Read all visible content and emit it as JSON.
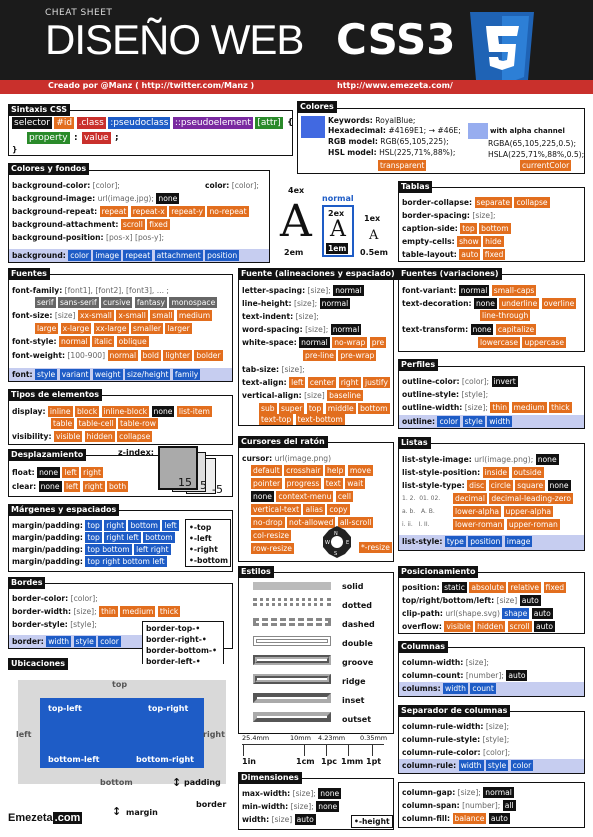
{
  "header": {
    "cheat": "CHEAT SHEET",
    "title_a": "DISEÑO WEB ",
    "title_b": "CSS3",
    "credit_by": "Creado por @Manz ( http://twitter.com/Manz )",
    "credit_url": "http://www.emezeta.com/",
    "shield_num": "3"
  },
  "sintaxis": {
    "title": "Sintaxis CSS",
    "sel": "selector",
    "id": "#id",
    "cls": ".class",
    "pc": ":pseudoclass",
    "pe": "::pseudoelement",
    "attr": "[attr]",
    "brace": "{",
    "prop": "property",
    "colon": ":",
    "val": "value",
    "semi": ";",
    "close": "}"
  },
  "colores": {
    "title": "Colores",
    "kw_l": "Keywords:",
    "kw_v": "RoyalBlue;",
    "hex_l": "Hexadecimal:",
    "hex_v": "#4169E1; → #46E;",
    "rgb_l": "RGB model:",
    "rgb_v": "RGB(65,105,225);",
    "hsl_l": "HSL model:",
    "hsl_v": "HSL(225,71%,88%);",
    "transparent": "transparent",
    "alpha": "with alpha channel",
    "rgba": "RGBA(65,105,225,0.5);",
    "hsla": "HSLA(225,71%,88%,0.5);",
    "current": "currentColor"
  },
  "fondos": {
    "title": "Colores y fondos",
    "r1l": "background-color:",
    "r1v": "[color];",
    "r1r": "color:",
    "r1rv": "[color];",
    "r2l": "background-image:",
    "r2v": "url(image.jpg);",
    "r2b": "none",
    "r3l": "background-repeat:",
    "r3a": "repeat",
    "r3b": "repeat-x",
    "r3c": "repeat-y",
    "r3d": "no-repeat",
    "r4l": "background-attachment:",
    "r4a": "scroll",
    "r4b": "fixed",
    "r5l": "background-position:",
    "r5v": "[pos-x] [pos-y];",
    "sh": "background:",
    "s1": "color",
    "s2": "image",
    "s3": "repeat",
    "s4": "attachment",
    "s5": "position"
  },
  "ems": {
    "a4": "4ex",
    "norm": "normal",
    "a2ex": "2ex",
    "a1ex": "1ex",
    "a2em": "2em",
    "a1em": "1em",
    "a05": "0.5em",
    "glyph": "A"
  },
  "tablas": {
    "title": "Tablas",
    "r1l": "border-collapse:",
    "r1a": "separate",
    "r1b": "collapse",
    "r2l": "border-spacing:",
    "r2v": "[size];",
    "r3l": "caption-side:",
    "r3a": "top",
    "r3b": "bottom",
    "r4l": "empty-cells:",
    "r4a": "show",
    "r4b": "hide",
    "r5l": "table-layout:",
    "r5a": "auto",
    "r5b": "fixed"
  },
  "fuentes": {
    "title": "Fuentes",
    "r1l": "font-family:",
    "r1v": "[font1], [font2], [font3], ... ;",
    "f1": "serif",
    "f2": "sans-serif",
    "f3": "cursive",
    "f4": "fantasy",
    "f5": "monospace",
    "r2l": "font-size:",
    "r2v": "[size]",
    "s1": "xx-small",
    "s2": "x-small",
    "s3": "small",
    "s4": "medium",
    "s5": "large",
    "s6": "x-large",
    "s7": "xx-large",
    "s8": "smaller",
    "s9": "larger",
    "r3l": "font-style:",
    "r3a": "normal",
    "r3b": "italic",
    "r3c": "oblique",
    "r4l": "font-weight:",
    "r4v": "[100-900]",
    "r4a": "normal",
    "r4b": "bold",
    "r4c": "lighter",
    "r4d": "bolder",
    "sh": "font:",
    "h1": "style",
    "h2": "variant",
    "h3": "weight",
    "h4": "size/height",
    "h5": "family"
  },
  "alin": {
    "title": "Fuente (alineaciones y espaciado)",
    "r1l": "letter-spacing:",
    "r1v": "[size];",
    "r1a": "normal",
    "r2l": "line-height:",
    "r2v": "[size];",
    "r2a": "normal",
    "r3l": "text-indent:",
    "r3v": "[size];",
    "r4l": "word-spacing:",
    "r4v": "[size];",
    "r4a": "normal",
    "r5l": "white-space:",
    "r5a": "normal",
    "r5b": "no-wrap",
    "r5c": "pre",
    "r5d": "pre-line",
    "r5e": "pre-wrap",
    "r6l": "tab-size:",
    "r6v": "[size];",
    "r7l": "text-align:",
    "r7a": "left",
    "r7b": "center",
    "r7c": "right",
    "r7d": "justify",
    "r8l": "vertical-align:",
    "r8v": "[size]",
    "r8a": "baseline",
    "r8b": "sub",
    "r8c": "super",
    "r8d": "top",
    "r8e": "middle",
    "r8f": "bottom",
    "r8g": "text-top",
    "r8h": "text-bottom"
  },
  "variac": {
    "title": "Fuentes (variaciones)",
    "r1l": "font-variant:",
    "r1a": "normal",
    "r1b": "small-caps",
    "r2l": "text-decoration:",
    "r2a": "none",
    "r2b": "underline",
    "r2c": "overline",
    "r2d": "line-through",
    "r3l": "text-transform:",
    "r3a": "none",
    "r3b": "capitalize",
    "r3c": "lowercase",
    "r3d": "uppercase"
  },
  "elementos": {
    "title": "Tipos de elementos",
    "r1l": "display:",
    "r1a": "inline",
    "r1b": "block",
    "r1c": "inline-block",
    "r1d": "none",
    "r1e": "list-item",
    "r1f": "table",
    "r1g": "table-cell",
    "r1h": "table-row",
    "r2l": "visibility:",
    "r2a": "visible",
    "r2b": "hidden",
    "r2c": "collapse"
  },
  "perfiles": {
    "title": "Perfiles",
    "r1l": "outline-color:",
    "r1v": "[color];",
    "r1a": "invert",
    "r2l": "outline-style:",
    "r2v": "[style];",
    "r3l": "outline-width:",
    "r3v": "[size];",
    "r3a": "thin",
    "r3b": "medium",
    "r3c": "thick",
    "sh": "outline:",
    "h1": "color",
    "h2": "style",
    "h3": "width"
  },
  "despl": {
    "title": "Desplazamiento",
    "z": "z-index:",
    "r1l": "float:",
    "r1a": "none",
    "r1b": "left",
    "r1c": "right",
    "r2l": "clear:",
    "r2a": "none",
    "r2b": "left",
    "r2c": "right",
    "r2d": "both",
    "n15": "15",
    "n5": "5",
    "n_5": "-5"
  },
  "cursores": {
    "title": "Cursores del ratón",
    "r1l": "cursor:",
    "r1v": "url(image.png)",
    "c1": "default",
    "c2": "crosshair",
    "c3": "help",
    "c4": "move",
    "c5": "pointer",
    "c6": "progress",
    "c7": "text",
    "c8": "wait",
    "c9": "none",
    "c10": "context-menu",
    "c11": "cell",
    "c12": "vertical-text",
    "c13": "alias",
    "c14": "copy",
    "c15": "no-drop",
    "c16": "not-allowed",
    "c17": "all-scroll",
    "c18": "col-resize",
    "c19": "row-resize",
    "c20": "*-resize"
  },
  "listas": {
    "title": "Listas",
    "r1l": "list-style-image:",
    "r1v": "url(image.png);",
    "r1a": "none",
    "r2l": "list-style-position:",
    "r2a": "inside",
    "r2b": "outside",
    "r3l": "list-style-type:",
    "r3a": "disc",
    "r3b": "circle",
    "r3c": "square",
    "r3d": "none",
    "n1": "1.  2.",
    "n2": "01. 02.",
    "n3": "a.   b.",
    "n4": "A.   B.",
    "n5": "i.  ii.",
    "n6": "I.   II.",
    "l1": "decimal",
    "l2": "decimal-leading-zero",
    "l3": "lower-alpha",
    "l4": "upper-alpha",
    "l5": "lower-roman",
    "l6": "upper-roman",
    "sh": "list-style:",
    "h1": "type",
    "h2": "position",
    "h3": "image"
  },
  "margenes": {
    "title": "Márgenes y espaciados",
    "lab": "margin/padding:",
    "a1": "top",
    "a2": "right",
    "a3": "bottom",
    "a4": "left",
    "b1": "top",
    "b2": "right left",
    "b3": "bottom",
    "c1": "top bottom",
    "c2": "left right",
    "d1": "top right bottom left",
    "k1": "•-top",
    "k2": "•-left",
    "k3": "•-right",
    "k4": "•-bottom"
  },
  "estilos": {
    "title": "Estilos",
    "e1": "solid",
    "e2": "dotted",
    "e3": "dashed",
    "e4": "double",
    "e5": "groove",
    "e6": "ridge",
    "e7": "inset",
    "e8": "outset"
  },
  "posic": {
    "title": "Posicionamiento",
    "r1l": "position:",
    "r1a": "static",
    "r1b": "absolute",
    "r1c": "relative",
    "r1d": "fixed",
    "r2l": "top/right/bottom/left:",
    "r2v": "[size]",
    "r2a": "auto",
    "r3l": "clip-path:",
    "r3v": "url(shape.svg)",
    "r3a": "shape",
    "r3b": "auto",
    "r4l": "overflow:",
    "r4a": "visible",
    "r4b": "hidden",
    "r4c": "scroll",
    "r4d": "auto"
  },
  "bordes": {
    "title": "Bordes",
    "r1l": "border-color:",
    "r1v": "[color];",
    "r2l": "border-width:",
    "r2v": "[size];",
    "r2a": "thin",
    "r2b": "medium",
    "r2c": "thick",
    "r3l": "border-style:",
    "r3v": "[style];",
    "sh": "border:",
    "h1": "width",
    "h2": "style",
    "h3": "color",
    "k1": "border-top-•",
    "k2": "border-right-•",
    "k3": "border-bottom-•",
    "k4": "border-left-•"
  },
  "columnas": {
    "title": "Columnas",
    "r1l": "column-width:",
    "r1v": "[size];",
    "r2l": "column-count:",
    "r2v": "[number];",
    "r2a": "auto",
    "sh": "columns:",
    "h1": "width",
    "h2": "count"
  },
  "ubic": {
    "title": "Ubicaciones",
    "top": "top",
    "left": "left",
    "right": "right",
    "bottom": "bottom",
    "tl": "top-left",
    "tr": "top-right",
    "bl": "bottom-left",
    "br": "bottom-right",
    "pad": "padding",
    "mar": "margin",
    "bor": "border"
  },
  "medidas": {
    "m1": "25.4mm",
    "m2": "10mm",
    "m3": "4.23mm",
    "m4": "0.35mm",
    "u1": "1in",
    "u2": "1cm",
    "u3": "1pc",
    "u4": "1mm",
    "u5": "1pt"
  },
  "separador": {
    "title": "Separador de columnas",
    "r1l": "column-rule-width:",
    "r1v": "[size];",
    "r2l": "column-rule-style:",
    "r2v": "[style];",
    "r3l": "column-rule-color:",
    "r3v": "[color];",
    "sh": "column-rule:",
    "h1": "width",
    "h2": "style",
    "h3": "color"
  },
  "dimens": {
    "title": "Dimensiones",
    "r1l": "max-width:",
    "r1v": "[size];",
    "r1a": "none",
    "r2l": "min-width:",
    "r2v": "[size];",
    "r2a": "none",
    "r3l": "width:",
    "r3v": "[size]",
    "r3a": "auto",
    "k": "•-height"
  },
  "colsx": {
    "r1l": "column-gap:",
    "r1v": "[size];",
    "r1a": "normal",
    "r2l": "column-span:",
    "r2v": "[number];",
    "r2a": "all",
    "r3l": "column-fill:",
    "r3a": "balance",
    "r3b": "auto"
  },
  "footer": {
    "logo": "Emezeta",
    "com": ".com"
  }
}
